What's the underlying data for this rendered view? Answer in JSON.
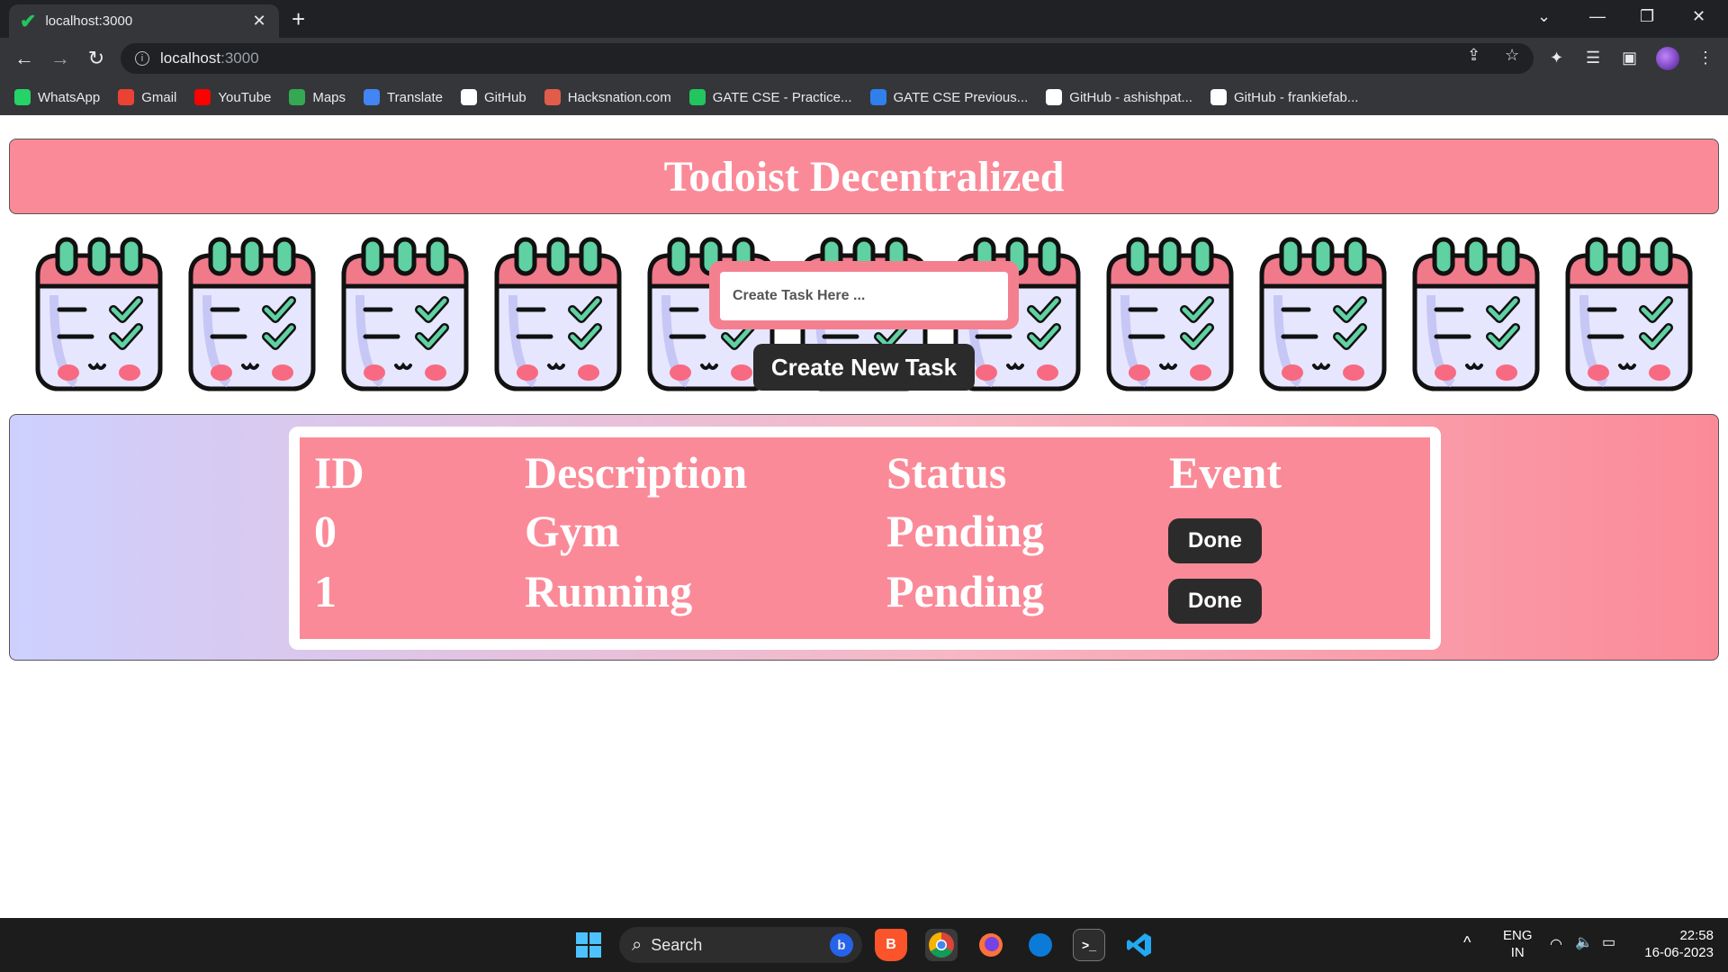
{
  "browser": {
    "tab_title": "localhost:3000",
    "url_host": "localhost",
    "url_port": ":3000",
    "bookmarks": [
      {
        "label": "WhatsApp",
        "icon": "whatsapp-icon",
        "color": "#25d366"
      },
      {
        "label": "Gmail",
        "icon": "gmail-icon",
        "color": "#ea4335"
      },
      {
        "label": "YouTube",
        "icon": "youtube-icon",
        "color": "#ff0000"
      },
      {
        "label": "Maps",
        "icon": "maps-icon",
        "color": "#34a853"
      },
      {
        "label": "Translate",
        "icon": "translate-icon",
        "color": "#4285f4"
      },
      {
        "label": "GitHub",
        "icon": "github-icon",
        "color": "#ffffff"
      },
      {
        "label": "Hacksnation.com",
        "icon": "hacksnation-icon",
        "color": "#e25c4a"
      },
      {
        "label": "GATE CSE - Practice...",
        "icon": "gate-practice-icon",
        "color": "#22c55e"
      },
      {
        "label": "GATE CSE Previous...",
        "icon": "gate-previous-icon",
        "color": "#2f80ed"
      },
      {
        "label": "GitHub - ashishpat...",
        "icon": "github-icon",
        "color": "#ffffff"
      },
      {
        "label": "GitHub - frankiefab...",
        "icon": "github-icon",
        "color": "#ffffff"
      }
    ]
  },
  "page": {
    "title": "Todoist Decentralized",
    "task_input_placeholder": "Create Task Here ...",
    "create_button": "Create New Task",
    "calendar_icon_count": 11,
    "colors": {
      "accent_pink": "#fb8a98",
      "button_dark": "#2b2b2b",
      "gradient_start": "#cdd0ff"
    },
    "table": {
      "headers": [
        "ID",
        "Description",
        "Status",
        "Event"
      ],
      "rows": [
        {
          "id": "0",
          "description": "Gym",
          "status": "Pending",
          "event": "Done"
        },
        {
          "id": "1",
          "description": "Running",
          "status": "Pending",
          "event": "Done"
        }
      ]
    }
  },
  "taskbar": {
    "search_label": "Search",
    "language": "ENG",
    "region": "IN",
    "time": "22:58",
    "date": "16-06-2023"
  }
}
